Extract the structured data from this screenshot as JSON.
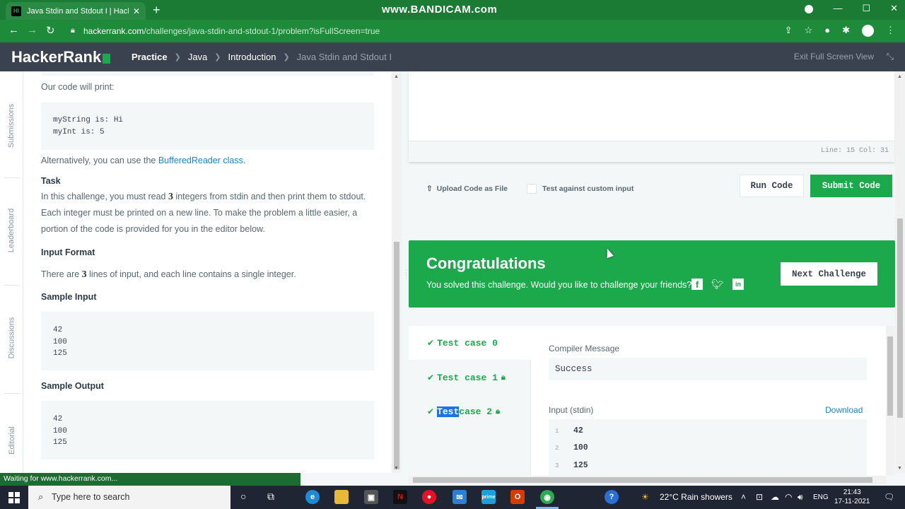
{
  "browser": {
    "tab_title": "Java Stdin and Stdout I | HackerRank",
    "tab_favicon_text": "HI",
    "watermark": "www.BANDICAM.com",
    "url_host": "hackerrank.com",
    "url_path": "/challenges/java-stdin-and-stdout-1/problem?isFullScreen=true",
    "status_text": "Waiting for www.hackerrank.com..."
  },
  "header": {
    "logo": "HackerRank",
    "breadcrumbs": [
      "Practice",
      "Java",
      "Introduction",
      "Java Stdin and Stdout I"
    ],
    "exit_fullscreen": "Exit Full Screen View"
  },
  "side_nav": [
    "Submissions",
    "Leaderboard",
    "Discussions",
    "Editorial"
  ],
  "problem": {
    "print_intro": "Our code will print:",
    "print_output": "myString is: Hi\nmyInt is: 5",
    "alt_prefix": "Alternatively, you can use the ",
    "alt_link": "BufferedReader class",
    "alt_suffix": ".",
    "task_heading": "Task",
    "task_p1": "In this challenge, you must read ",
    "task_num": "3",
    "task_p2": " integers from stdin and then print them to stdout. Each integer must be printed on a new line. To make the problem a little easier, a portion of the code is provided for you in the editor below.",
    "input_format_heading": "Input Format",
    "input_p1": "There are ",
    "input_num": "3",
    "input_p2": " lines of input, and each line contains a single integer.",
    "sample_input_heading": "Sample Input",
    "sample_input": "42\n100\n125",
    "sample_output_heading": "Sample Output",
    "sample_output": "42\n100\n125"
  },
  "editor": {
    "line_col": "Line: 15 Col: 31",
    "upload_label": "Upload Code as File",
    "custom_input_label": "Test against custom input",
    "run_label": "Run Code",
    "submit_label": "Submit Code"
  },
  "congrats": {
    "title": "Congratulations",
    "subtitle": "You solved this challenge. Would you like to challenge your friends?",
    "next_label": "Next Challenge"
  },
  "results": {
    "test_cases": [
      {
        "prefix": "",
        "label": "Test case 0",
        "locked": false
      },
      {
        "prefix": "",
        "label": "Test case 1",
        "locked": true
      },
      {
        "prefix": "Test",
        "label": " case 2",
        "locked": true
      }
    ],
    "compiler_label": "Compiler Message",
    "compiler_message": "Success",
    "input_label": "Input (stdin)",
    "download_label": "Download",
    "input_lines": [
      {
        "n": "1",
        "v": "42"
      },
      {
        "n": "2",
        "v": "100"
      },
      {
        "n": "3",
        "v": "125"
      }
    ]
  },
  "taskbar": {
    "search_placeholder": "Type here to search",
    "weather": "22°C  Rain showers",
    "lang": "ENG",
    "time": "21:43",
    "date": "17-11-2021"
  },
  "colors": {
    "brand_green": "#1ba94c",
    "header_dark": "#39424e",
    "link_blue": "#1a85c6"
  }
}
